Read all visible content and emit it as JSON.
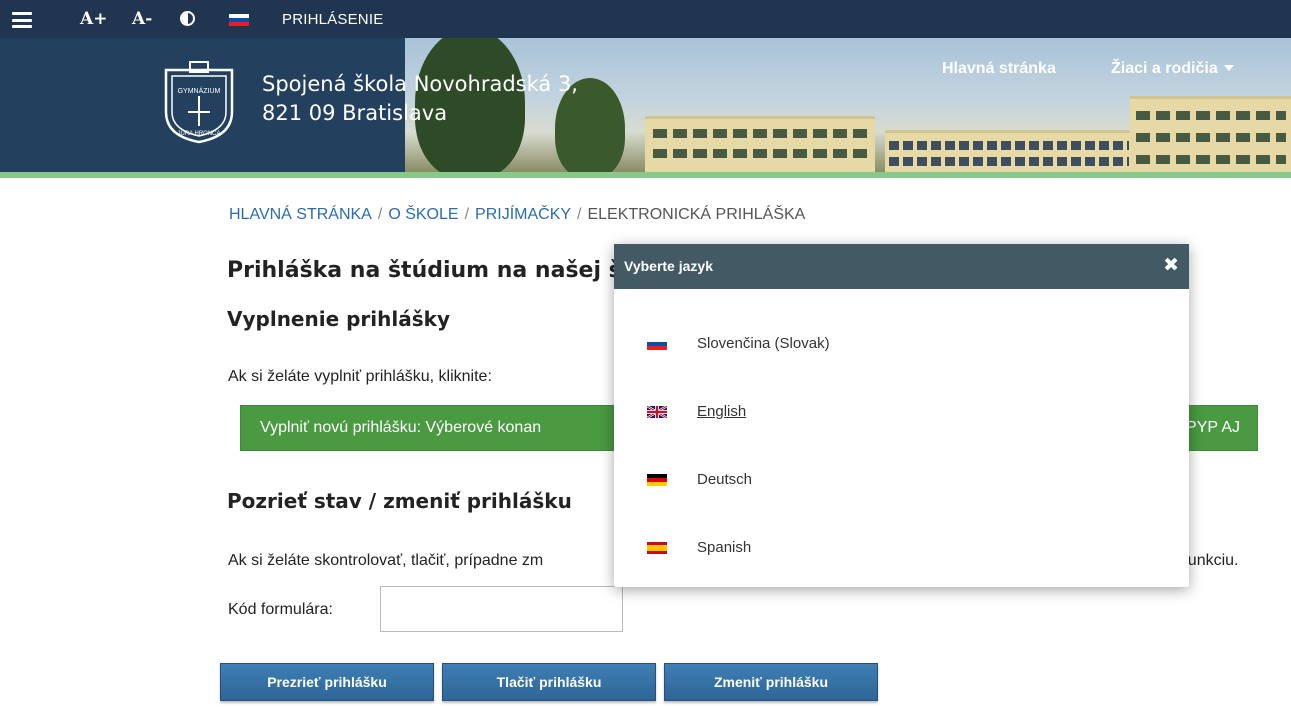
{
  "topbar": {
    "font_increase": "A+",
    "font_decrease": "A-",
    "contrast_icon": "contrast-icon",
    "language_flag": "flag-slovakia-icon",
    "login": "PRIHLÁSENIE"
  },
  "header": {
    "school_name_line1": "Spojená škola Novohradská 3,",
    "school_name_line2": "821 09 Bratislava",
    "crest_text_top": "GYMNÁZIUM",
    "crest_text_bottom": "JURA HRONCA",
    "nav_home": "Hlavná stránka",
    "nav_students": "Žiaci a rodičia"
  },
  "breadcrumb": {
    "home": "HLAVNÁ STRÁNKA",
    "about": "O ŠKOLE",
    "admissions": "PRIJÍMAČKY",
    "current": "ELEKTRONICKÁ PRIHLÁŠKA"
  },
  "content": {
    "page_title": "Prihláška na štúdium na našej š",
    "fill_heading": "Vyplnenie prihlášky",
    "fill_text": "Ak si želáte vyplniť prihlášku, kliknite:",
    "new_form_left": "Vyplniť novú prihlášku: Výberové konan",
    "new_form_right": "PYP AJ",
    "status_heading": "Pozrieť stav / zmeniť prihlášku",
    "status_text_left": "Ak si želáte skontrolovať, tlačiť, prípadne zm",
    "status_text_right": "ú funkciu.",
    "code_label": "Kód formulára:",
    "code_value": "",
    "view_button": "Prezrieť prihlášku",
    "print_button": "Tlačiť prihlášku",
    "edit_button": "Zmeniť prihlášku"
  },
  "modal": {
    "title": "Vyberte jazyk",
    "close_icon": "close-icon",
    "languages": [
      {
        "name": "Slovenčina (Slovak)",
        "flag": "flag-slovakia-icon"
      },
      {
        "name": "English",
        "flag": "flag-uk-icon"
      },
      {
        "name": "Deutsch",
        "flag": "flag-germany-icon"
      },
      {
        "name": "Spanish",
        "flag": "flag-spain-icon"
      }
    ]
  },
  "colors": {
    "topbar": "#1f3550",
    "header": "#24405f",
    "accent_green": "#4a9a42",
    "button_blue": "#2e6596",
    "modal_header": "#435a65",
    "link": "#2b6cb0"
  }
}
